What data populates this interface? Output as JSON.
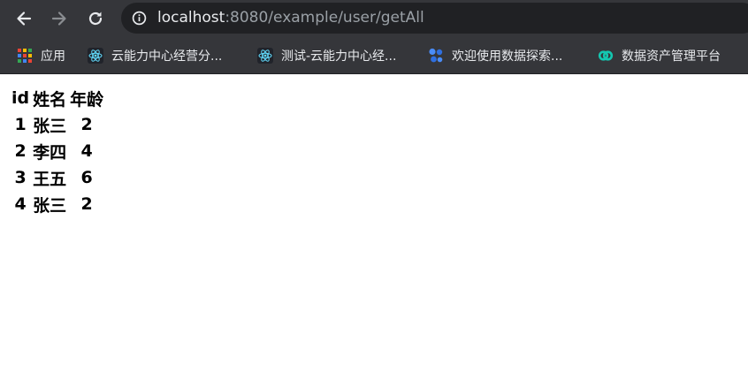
{
  "browser": {
    "url": {
      "host": "localhost",
      "rest": ":8080/example/user/getAll"
    },
    "bookmarks": [
      {
        "label": "应用",
        "icon": "apps-grid-icon"
      },
      {
        "label": "云能力中心经营分...",
        "icon": "react-icon"
      },
      {
        "label": "测试-云能力中心经...",
        "icon": "react-icon"
      },
      {
        "label": "欢迎使用数据探索...",
        "icon": "data-explore-icon"
      },
      {
        "label": "数据资产管理平台",
        "icon": "data-asset-icon"
      }
    ]
  },
  "table": {
    "headers": [
      "id",
      "姓名",
      "年龄"
    ],
    "rows": [
      [
        "1",
        "张三",
        "2"
      ],
      [
        "2",
        "李四",
        "4"
      ],
      [
        "3",
        "王五",
        "6"
      ],
      [
        "4",
        "张三",
        "2"
      ]
    ]
  }
}
